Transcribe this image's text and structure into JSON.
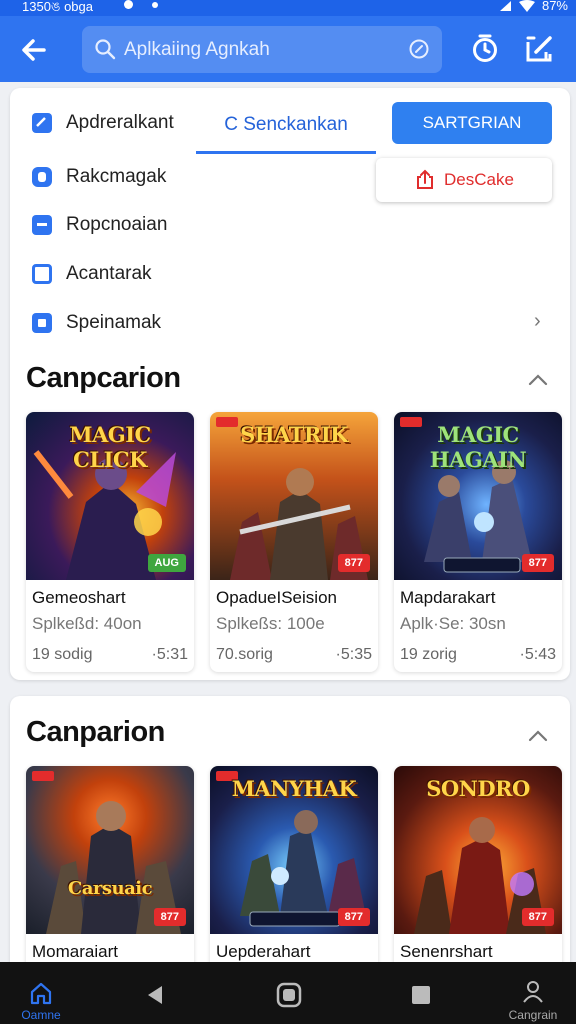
{
  "status_bar": {
    "time": "1350ঙ obga",
    "battery": "87%"
  },
  "search": {
    "placeholder": "Aplkaiing Agnkah"
  },
  "categories": [
    {
      "label": "Apdreralkant",
      "icon": "checklist-icon"
    },
    {
      "label": "Rakcmagak",
      "icon": "shield-icon"
    },
    {
      "label": "Ropcnoaian",
      "icon": "bag-icon"
    },
    {
      "label": "Acantarak",
      "icon": "square-icon"
    },
    {
      "label": "Speinamak",
      "icon": "square-filled-icon"
    }
  ],
  "tab_active_label": "C Senckankan",
  "primary_button_label": "SARTGRIAN",
  "share_button_label": "DesCake",
  "sections": [
    {
      "title": "Canpcarion",
      "games": [
        {
          "logo": "MAGIC CLICK",
          "name": "Gemeoshart",
          "sub": "Splkeßd: 40on",
          "foot": "19 sodig",
          "foot2": "·5:31",
          "badge": "AUG",
          "badge_color": "green"
        },
        {
          "logo": "SHATRIK",
          "name": "OpadueISeision",
          "sub": "Splkeßs: 100e",
          "foot": "70.sorig",
          "foot2": "·5:35",
          "badge": "877",
          "badge_color": "red"
        },
        {
          "logo": "MAGIC HAGAIN",
          "name": "Mapdarakart",
          "sub": "Aplk·Se: 30sn",
          "foot": "19 zorig",
          "foot2": "·5:43",
          "badge": "877",
          "badge_color": "red"
        }
      ]
    },
    {
      "title": "Canparion",
      "games": [
        {
          "logo": "Carsuaic",
          "name": "Momaraiart",
          "badge": "877",
          "badge_color": "red"
        },
        {
          "logo": "MANYHAK",
          "name": "Uepderahart",
          "badge": "877",
          "badge_color": "red"
        },
        {
          "logo": "SONDRO",
          "name": "Senenrshart",
          "badge": "877",
          "badge_color": "red"
        }
      ]
    }
  ],
  "nav": {
    "home_label": "Oamne",
    "profile_label": "Cangrain"
  },
  "colors": {
    "primary": "#2f74f0",
    "accent_red": "#e32c2c"
  }
}
